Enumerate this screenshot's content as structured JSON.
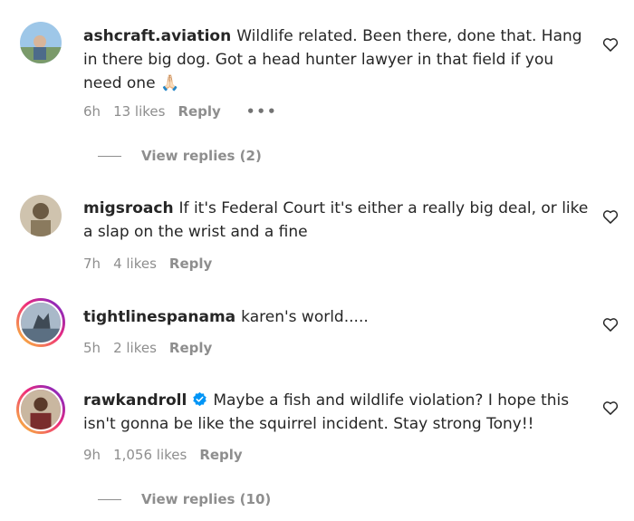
{
  "comments": [
    {
      "username": "ashcraft.aviation",
      "text": "Wildlife related. Been there, done that. Hang in there big dog. Got a head hunter lawyer in that field if you need one",
      "emoji": "🙏🏻",
      "time": "6h",
      "likes": "13 likes",
      "reply": "Reply",
      "more": "•••",
      "view_replies": "View replies (2)",
      "verified": false
    },
    {
      "username": "migsroach",
      "text": "If it's Federal Court it's either a really big deal, or like a slap on the wrist and a fine",
      "time": "7h",
      "likes": "4 likes",
      "reply": "Reply",
      "verified": false
    },
    {
      "username": "tightlinespanama",
      "text": "karen's world.....",
      "time": "5h",
      "likes": "2 likes",
      "reply": "Reply",
      "verified": false
    },
    {
      "username": "rawkandroll",
      "text": "Maybe a fish and wildlife violation? I hope this isn't gonna be like the squirrel incident. Stay strong Tony!!",
      "time": "9h",
      "likes": "1,056 likes",
      "reply": "Reply",
      "view_replies": "View replies (10)",
      "verified": true
    }
  ],
  "icons": {
    "heart": "heart-outline-icon",
    "verified": "verified-badge-icon",
    "verified_color": "#0095f6"
  }
}
